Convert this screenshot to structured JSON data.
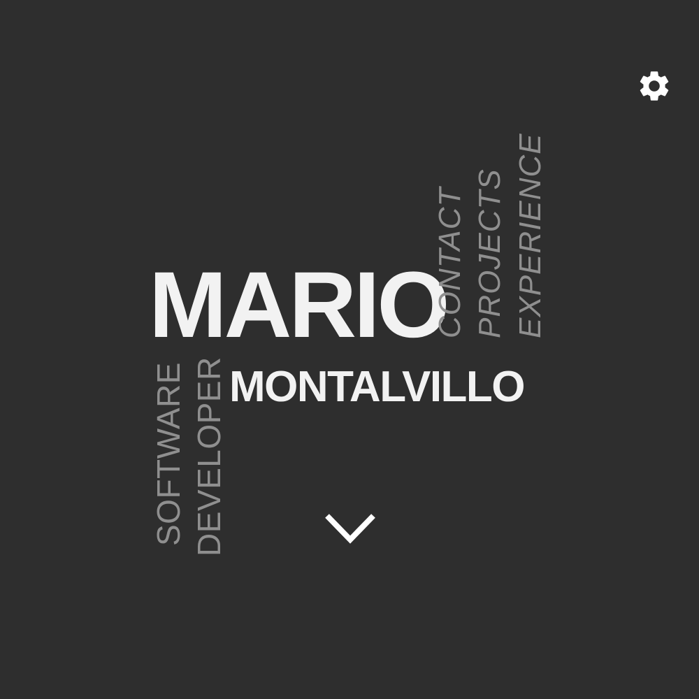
{
  "hero": {
    "first_name": "MARIO",
    "last_name": "MONTALVILLO",
    "role": [
      "SOFTWARE",
      "DEVELOPER"
    ]
  },
  "nav": {
    "items": [
      {
        "label": "CONTACT"
      },
      {
        "label": "PROJECTS"
      },
      {
        "label": "EXPERIENCE"
      }
    ]
  },
  "icons": {
    "settings": "gear-icon",
    "scroll": "chevron-down-icon"
  },
  "colors": {
    "background": "#2e2e2e",
    "name_text": "#f2f2f2",
    "muted_text": "#8f8f8f",
    "icon": "#ffffff"
  }
}
